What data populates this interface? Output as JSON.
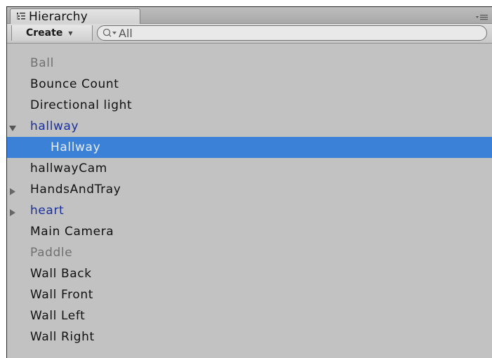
{
  "tab": {
    "title": "Hierarchy",
    "icon": "hierarchy-list-icon"
  },
  "toolbar": {
    "create_label": "Create",
    "create_caret": "▼",
    "search_placeholder": "All",
    "search_icon": "search-dropdown-icon"
  },
  "menu_icon": "panel-menu-icon",
  "items": [
    {
      "label": "Ball",
      "style": "disabled"
    },
    {
      "label": "Bounce Count",
      "style": "normal"
    },
    {
      "label": "Directional light",
      "style": "normal"
    },
    {
      "label": "hallway",
      "style": "prefab",
      "expander": "expanded"
    },
    {
      "label": "Hallway",
      "style": "selected",
      "child": true
    },
    {
      "label": "hallwayCam",
      "style": "normal"
    },
    {
      "label": "HandsAndTray",
      "style": "normal",
      "expander": "collapsed"
    },
    {
      "label": "heart",
      "style": "prefab",
      "expander": "collapsed"
    },
    {
      "label": "Main Camera",
      "style": "normal"
    },
    {
      "label": "Paddle",
      "style": "disabled"
    },
    {
      "label": "Wall Back",
      "style": "normal"
    },
    {
      "label": "Wall Front",
      "style": "normal"
    },
    {
      "label": "Wall Left",
      "style": "normal"
    },
    {
      "label": "Wall Right",
      "style": "normal"
    }
  ],
  "colors": {
    "selection": "#3b81d8",
    "prefab_text": "#1a2f9e",
    "disabled_text": "#707070",
    "panel_bg": "#c2c2c2"
  }
}
